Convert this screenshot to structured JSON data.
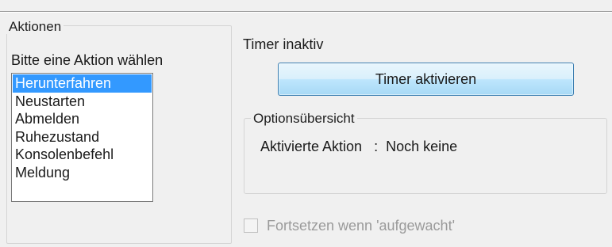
{
  "actions_group": {
    "title": "Aktionen",
    "prompt": "Bitte eine Aktion wählen",
    "items": [
      "Herunterfahren",
      "Neustarten",
      "Abmelden",
      "Ruhezustand",
      "Konsolenbefehl",
      "Meldung"
    ],
    "selected_item": "Herunterfahren"
  },
  "timer": {
    "status": "Timer inaktiv",
    "activate_label": "Timer aktivieren"
  },
  "options_group": {
    "title": "Optionsübersicht",
    "action_label": "Aktivierte Aktion",
    "separator": ":",
    "action_value": "Noch keine"
  },
  "resume_checkbox": {
    "label": "Fortsetzen wenn 'aufgewacht'",
    "checked": false,
    "enabled": false
  },
  "colors": {
    "selection": "#3399ff",
    "button_border": "#3c7fb1",
    "disabled_text": "#9a9a9a"
  }
}
